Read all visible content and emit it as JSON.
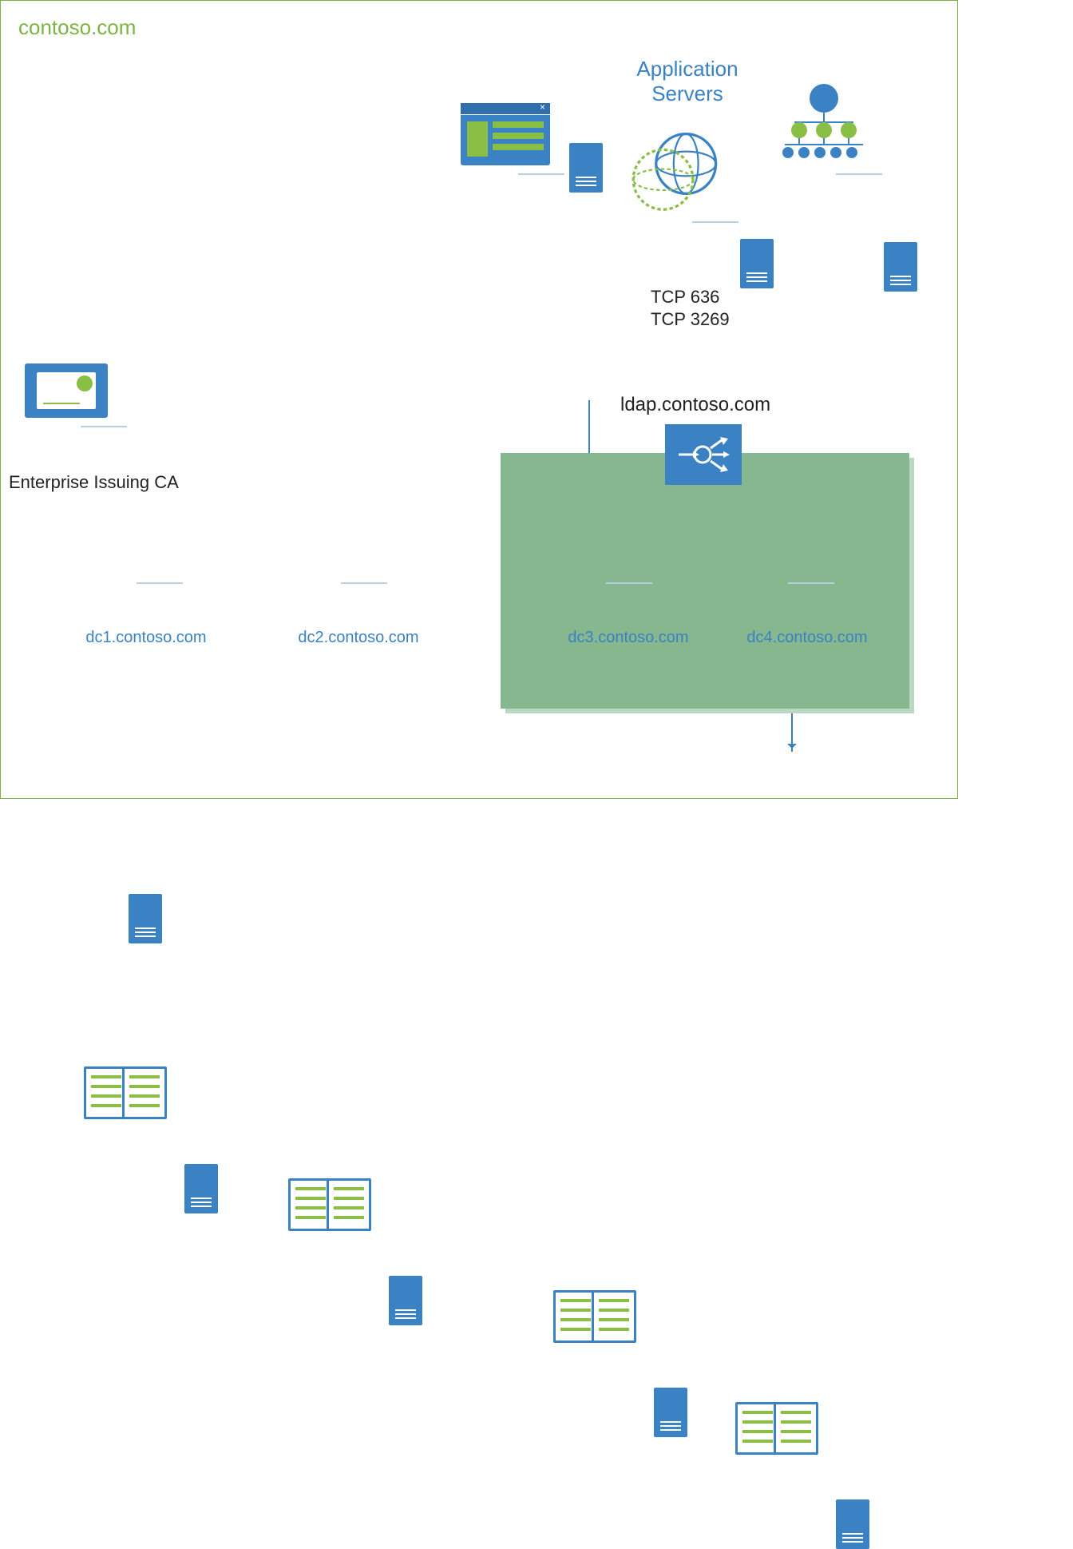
{
  "domain_title": "contoso.com",
  "app_servers_title": "Application\nServers",
  "ports": {
    "line1": "TCP 636",
    "line2": "TCP 3269"
  },
  "ldap_host": "ldap.contoso.com",
  "ca_label": "Enterprise Issuing CA",
  "dc": {
    "d1": "dc1.contoso.com",
    "d2": "dc2.contoso.com",
    "d3": "dc3.contoso.com",
    "d4": "dc4.contoso.com"
  },
  "colors": {
    "blue": "#3a82c4",
    "green": "#7cb342",
    "cluster": "#86b78e"
  }
}
